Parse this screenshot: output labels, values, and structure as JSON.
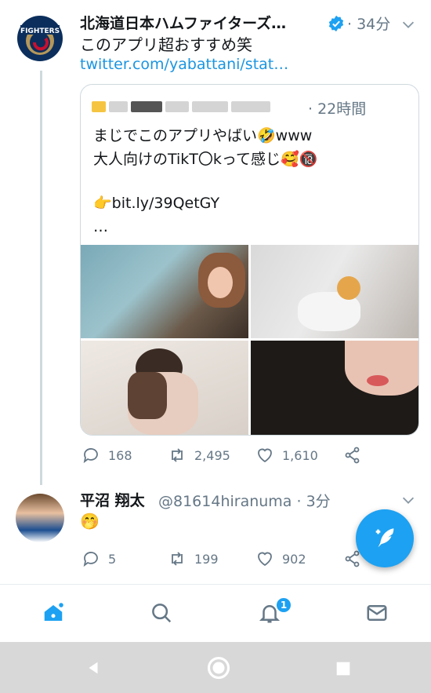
{
  "tweet1": {
    "name": "北海道日本ハムファイターズ…",
    "time": "· 34分",
    "text": "このアプリ超おすすめ笑",
    "link": "twitter.com/yabattani/stat…",
    "avatar_text": "FIGHTERS"
  },
  "quote": {
    "time": "· 22時間",
    "line1": "まじでこのアプリやばい🤣www",
    "line2": "大人向けのTikT〇kって感じ🥰🔞",
    "line3": "👉bit.ly/39QetGY",
    "line4": "…"
  },
  "tweet1_actions": {
    "reply": "168",
    "retweet": "2,495",
    "like": "1,610"
  },
  "tweet2": {
    "name": "平沼 翔太",
    "handle_time": "@81614hiranuma · 3分",
    "text": "🤭"
  },
  "tweet2_actions": {
    "reply": "5",
    "retweet": "199",
    "like": "902"
  },
  "tabs": {
    "notifications_badge": "1"
  },
  "colors": {
    "accent": "#1da1f2",
    "muted": "#657786",
    "divider": "#e6ecf0"
  },
  "icons": [
    "verified-icon",
    "chevron-down-icon",
    "reply-icon",
    "retweet-icon",
    "like-icon",
    "share-icon",
    "home-icon",
    "search-icon",
    "bell-icon",
    "mail-icon",
    "compose-icon",
    "back-icon",
    "home-nav-icon",
    "recents-icon"
  ]
}
